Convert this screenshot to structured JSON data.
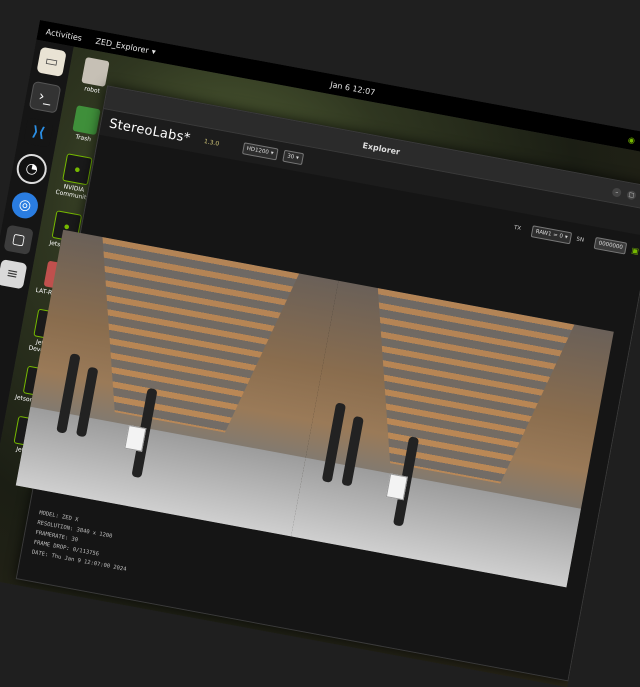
{
  "topbar": {
    "activities": "Activities",
    "app_menu": "ZED_Explorer",
    "clock": "Jan 6 12:07"
  },
  "dock": {
    "items": [
      {
        "icon": "files-icon"
      },
      {
        "icon": "terminal-icon"
      },
      {
        "icon": "vscode-icon"
      },
      {
        "icon": "obs-icon"
      },
      {
        "icon": "chromium-icon"
      },
      {
        "icon": "app-icon"
      },
      {
        "icon": "text-editor-icon"
      }
    ]
  },
  "desktop": {
    "icons": [
      {
        "label": "robot",
        "icon": "home-folder-icon"
      },
      {
        "label": "Trash",
        "icon": "trash-icon"
      },
      {
        "label": "NVIDIA Community",
        "icon": "nvidia-icon"
      },
      {
        "label": "Jetson Zo",
        "icon": "nvidia-icon"
      },
      {
        "label": "LAT-README",
        "icon": "document-icon"
      },
      {
        "label": "Jetson Developer",
        "icon": "nvidia-icon"
      },
      {
        "label": "Jetson Forum",
        "icon": "nvidia-icon"
      },
      {
        "label": "Jetson",
        "icon": "nvidia-icon"
      }
    ]
  },
  "window": {
    "title": "Explorer",
    "logo": "StereoLabs*",
    "version": "1.3.0",
    "resolution_select": "HD1200",
    "fps_select": "30",
    "side_controls": {
      "label_a": "TX",
      "select_a": "RAW1 = 0",
      "label_b": "SN",
      "input_b": "0000000"
    },
    "info": {
      "model": "MODEL: ZED X",
      "resolution": "RESOLUTION: 3840 x 1200",
      "framerate": "FRAMERATE: 30",
      "frame_drop": "FRAME DROP: 0/113756",
      "date": "DATE: Thu Jan 9 12:07:00 2024"
    }
  },
  "colors": {
    "nvidia_green": "#76b900",
    "version_yellow": "#d4c97a",
    "window_bg": "#202020"
  }
}
